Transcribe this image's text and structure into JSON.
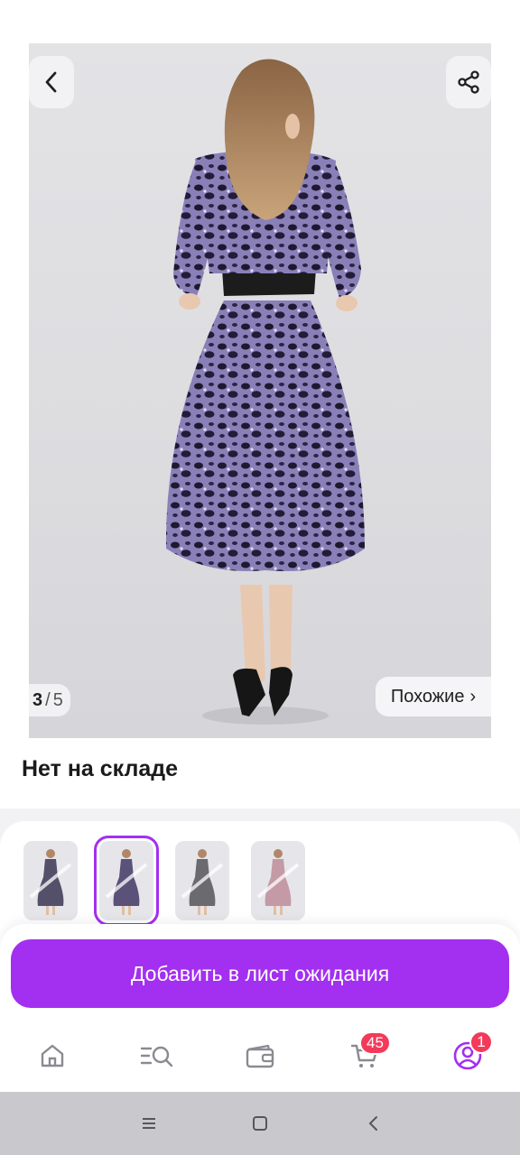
{
  "gallery": {
    "current": "3",
    "separator": "/",
    "total": "5",
    "similar_label": "Похожие",
    "similar_chevron": "›",
    "back_icon": "chevron-left-icon",
    "share_icon": "share-icon"
  },
  "product": {
    "stock_status": "Нет на складе"
  },
  "thumbnails": [
    {
      "selected": false,
      "dress_color": "#55506a"
    },
    {
      "selected": true,
      "dress_color": "#5a5278"
    },
    {
      "selected": false,
      "dress_color": "#6a6a70"
    },
    {
      "selected": false,
      "dress_color": "#c49aa6"
    }
  ],
  "cta": {
    "label": "Добавить в лист ожидания",
    "color": "#a32ff0"
  },
  "tabbar": {
    "items": [
      {
        "icon": "home-icon"
      },
      {
        "icon": "catalog-search-icon"
      },
      {
        "icon": "wallet-icon"
      },
      {
        "icon": "cart-icon",
        "badge": "45"
      },
      {
        "icon": "profile-icon",
        "badge": "1"
      }
    ]
  },
  "system_nav": {
    "items": [
      "recents-icon",
      "home-square-icon",
      "back-icon"
    ]
  },
  "colors": {
    "accent": "#a32ff0",
    "badge": "#f33a5a"
  }
}
